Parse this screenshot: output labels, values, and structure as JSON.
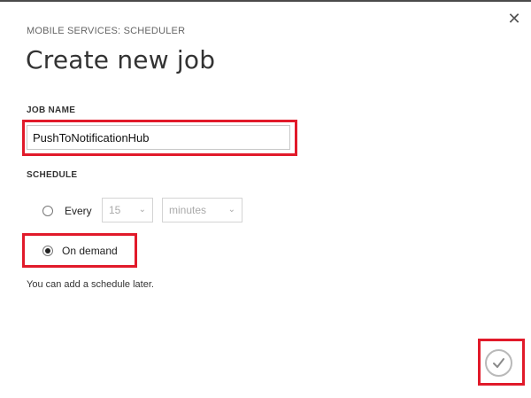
{
  "header": {
    "breadcrumb": "MOBILE SERVICES: SCHEDULER",
    "title": "Create new job",
    "close_icon": "close-icon"
  },
  "job_name": {
    "label": "JOB NAME",
    "value": "PushToNotificationHub"
  },
  "schedule": {
    "label": "SCHEDULE",
    "every_label": "Every",
    "interval_value": "15",
    "unit_value": "minutes",
    "on_demand_label": "On demand",
    "selected": "On demand"
  },
  "hint": "You can add a schedule later.",
  "footer": {
    "confirm_icon": "checkmark-icon"
  },
  "colors": {
    "highlight": "#e11a2a",
    "title": "#333333",
    "disabled_text": "#aaaaaa"
  }
}
